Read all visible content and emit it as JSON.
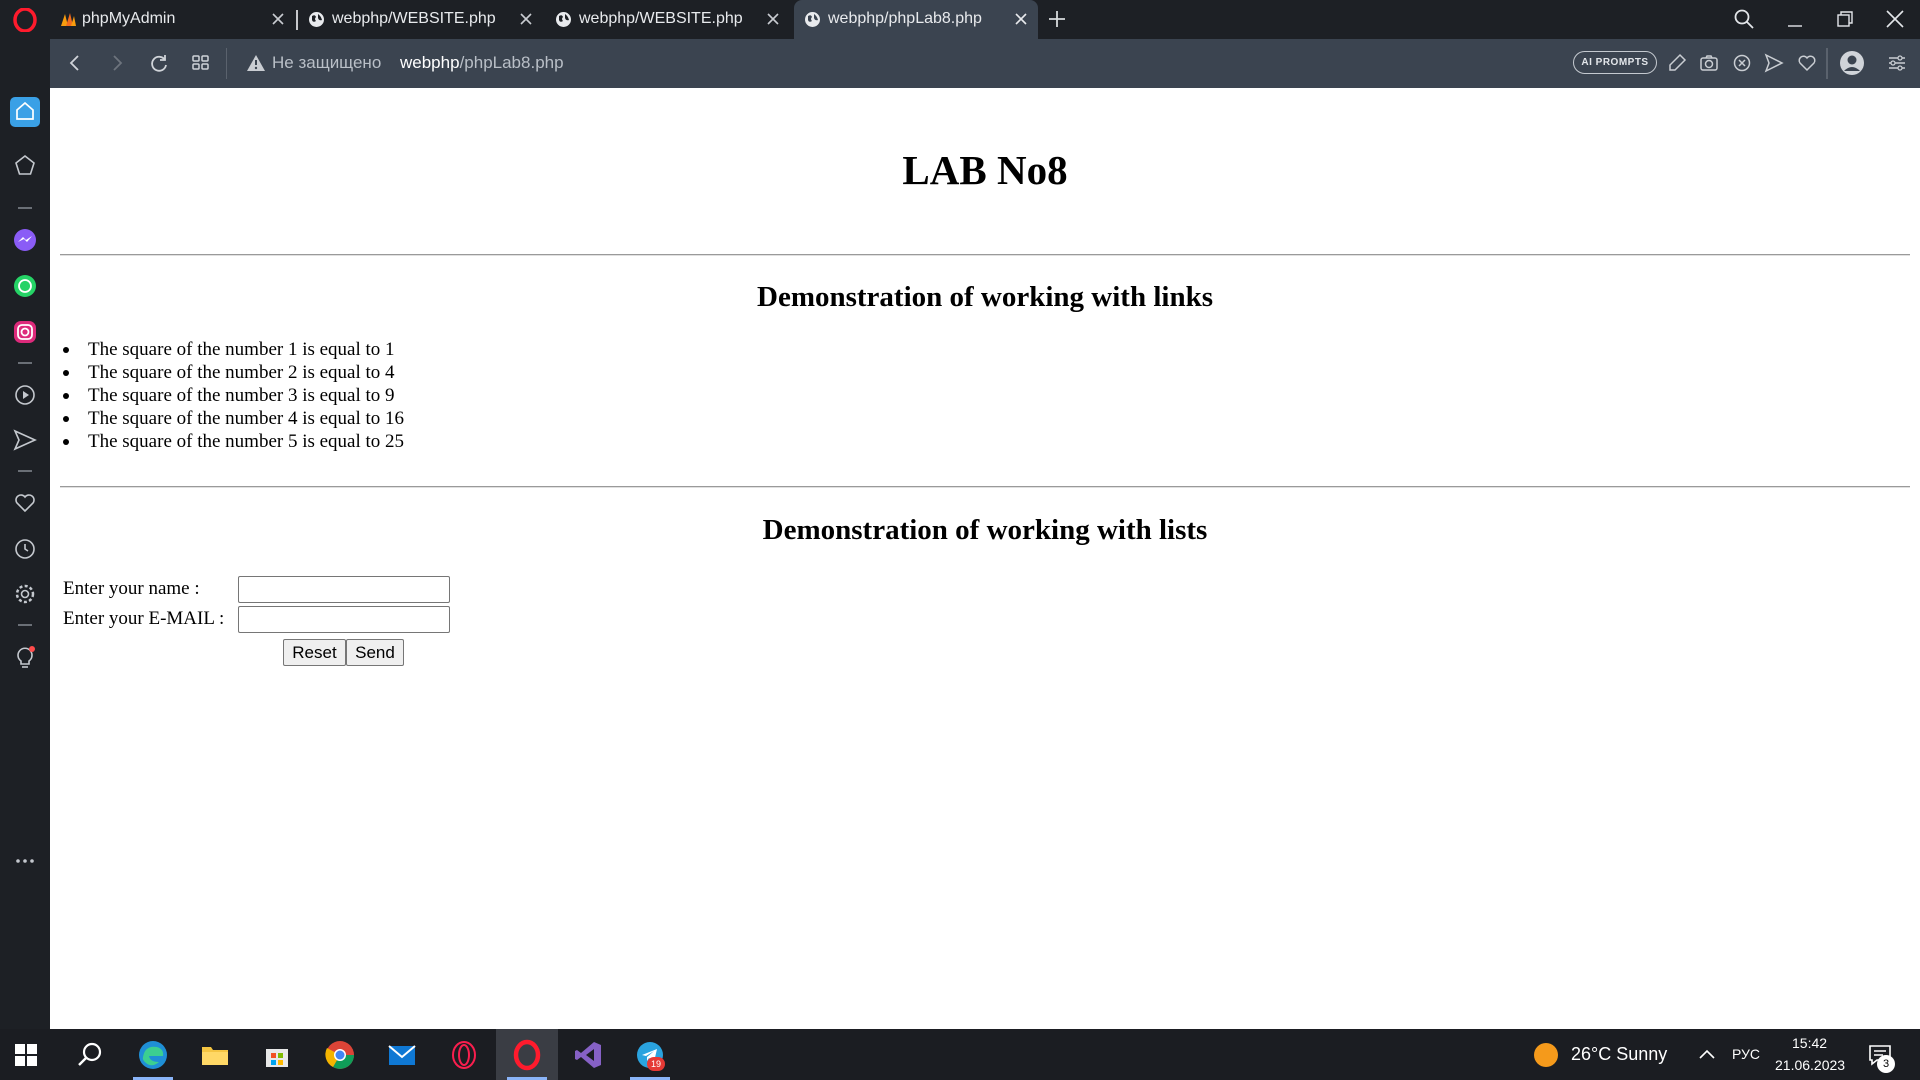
{
  "browser": {
    "tabs": [
      {
        "title": "phpMyAdmin",
        "favicon": "phpmyadmin-icon",
        "active": false
      },
      {
        "title": "webphp/WEBSITE.php",
        "favicon": "globe-icon",
        "active": false
      },
      {
        "title": "webphp/WEBSITE.php",
        "favicon": "globe-icon",
        "active": false
      },
      {
        "title": "webphp/phpLab8.php",
        "favicon": "globe-icon",
        "active": true
      }
    ],
    "security_label": "Не защищено",
    "url_host": "webphp",
    "url_path": "/phpLab8.php",
    "ai_prompts_label": "AI PROMPTS",
    "accent_color": "#3b4450",
    "chrome_color": "#1d2025"
  },
  "page": {
    "title": "LAB No8",
    "links_section": {
      "heading": "Demonstration of working with links",
      "items": [
        "The square of the number 1 is equal to 1",
        "The square of the number 2 is equal to 4",
        "The square of the number 3 is equal to 9",
        "The square of the number 4 is equal to 16",
        "The square of the number 5 is equal to 25"
      ]
    },
    "lists_section": {
      "heading": "Demonstration of working with lists",
      "name_label": "Enter your name :",
      "name_value": "",
      "email_label": "Enter your E-MAIL :",
      "email_value": "",
      "reset_label": "Reset",
      "send_label": "Send"
    }
  },
  "taskbar": {
    "weather_temp": "26°C",
    "weather_desc": "Sunny",
    "weather_text": "26°C  Sunny",
    "language": "РУС",
    "time": "15:42",
    "date": "21.06.2023",
    "notification_count": "3",
    "telegram_badge": "19"
  }
}
